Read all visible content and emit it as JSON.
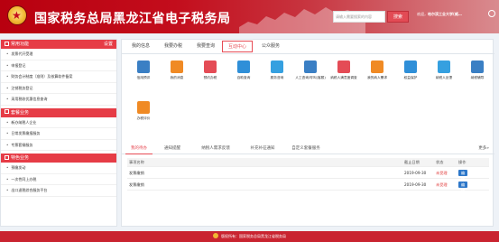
{
  "header": {
    "title": "国家税务总局黑龙江省电子税务局",
    "search_placeholder": "请输入需要搜索的内容",
    "search_label": "搜索",
    "welcome_prefix": "欢迎，",
    "welcome_user": "哈尔滨工业大学(威…"
  },
  "sidebar": {
    "sections": [
      {
        "title": "常用功能",
        "action": "设置",
        "items": [
          "发票代开受理",
          "申报登记",
          "财务会计制度（准则）及核算软件备案",
          "注销税务登记",
          "采用税收优惠信息查询"
        ]
      },
      {
        "title": "套餐业务",
        "items": [
          "新办纳税人企业",
          "日常发票缴报服务",
          "专票套餐服务"
        ]
      },
      {
        "title": "特色业务",
        "items": [
          "预缴发动",
          "一次性同上办税",
          "出口退税综合服务平台"
        ]
      }
    ]
  },
  "main": {
    "tabs": [
      "我的信息",
      "我要办税",
      "我要查询",
      "互动中心",
      "公众服务"
    ],
    "active_tab": 3,
    "functions": [
      {
        "label": "信用预评",
        "color": "#3a7fc4",
        "icon": "chart-icon"
      },
      {
        "label": "我的消息",
        "color": "#f08a24",
        "icon": "message-icon"
      },
      {
        "label": "预约办税",
        "color": "#e44c56",
        "icon": "clock-icon"
      },
      {
        "label": "自助查询",
        "color": "#2f8fd8",
        "icon": "search-icon"
      },
      {
        "label": "服务咨询",
        "color": "#35a0e0",
        "icon": "chat-icon"
      },
      {
        "label": "人工咨询/呼叫(客服)",
        "color": "#3a7fc4",
        "icon": "person-icon"
      },
      {
        "label": "纳税人满意度调查",
        "color": "#e44c56",
        "icon": "survey-icon"
      },
      {
        "label": "我的纳人需求",
        "color": "#f08a24",
        "icon": "user-icon"
      },
      {
        "label": "权益保护",
        "color": "#2f8fd8",
        "icon": "shield-icon"
      },
      {
        "label": "纳税人反馈",
        "color": "#35a0e0",
        "icon": "feedback-icon"
      },
      {
        "label": "纳税辅导",
        "color": "#3a7fc4",
        "icon": "book-icon"
      },
      {
        "label": "办税评价",
        "color": "#f08a24",
        "icon": "rating-icon"
      }
    ],
    "subtabs": [
      "我的待办",
      "通知提醒",
      "纳税人需求反馈",
      "补充补征通知",
      "自定义套餐服务"
    ],
    "active_subtab": 0,
    "more_label": "更多»",
    "table": {
      "headers": [
        "事项名称",
        "截止日期",
        "状态",
        "操作"
      ],
      "rows": [
        {
          "name": "发票缴销",
          "date": "2019-09-30",
          "status": "未受理",
          "action": "编辑"
        },
        {
          "name": "发票缴销",
          "date": "2019-09-30",
          "status": "未受理",
          "action": "编辑"
        }
      ]
    }
  },
  "footer": {
    "text": "版权所有：国家税务总局黑龙江省税务局"
  }
}
